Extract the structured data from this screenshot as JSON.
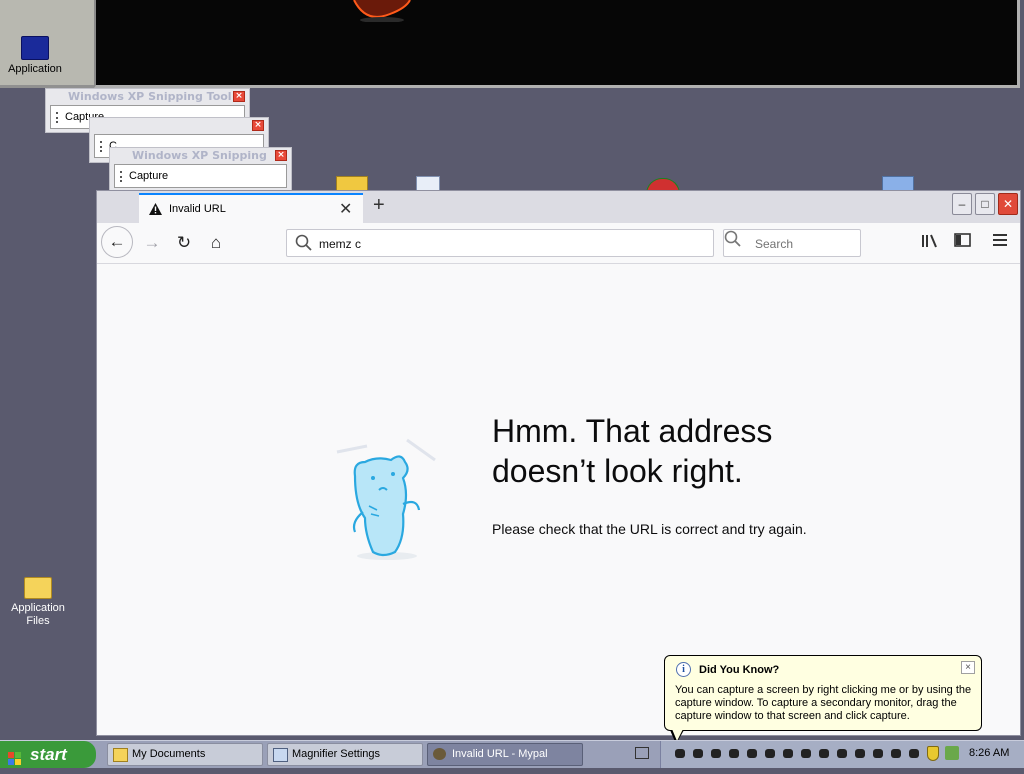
{
  "desktop": {
    "top_icon_label": "Application Files",
    "bottom_icon_label": "Application Files"
  },
  "snipping_tool": {
    "title": "Windows XP Snipping Tool",
    "capture_label": "Capture",
    "close_glyph": "×",
    "partial_label": "C"
  },
  "browser": {
    "tab_title": "Invalid URL",
    "tab_close": "✕",
    "new_tab": "+",
    "window_buttons": {
      "minimize": "–",
      "maximize": "□",
      "close": "✕"
    },
    "nav": {
      "back": "←",
      "forward": "→",
      "reload": "↻",
      "home": "⌂"
    },
    "url_value": "memz c",
    "search_placeholder": "Search",
    "toolbar_icons": [
      "library-icon",
      "sidebar-icon",
      "menu-icon"
    ],
    "error": {
      "title": "Hmm. That address doesn’t look right.",
      "description": "Please check that the URL is correct and try again."
    }
  },
  "balloon": {
    "title": "Did You Know?",
    "text": "You can capture a screen by right clicking me or by using the capture window. To capture a secondary monitor, drag the capture window to that screen and click capture.",
    "info_glyph": "i",
    "close_glyph": "×"
  },
  "taskbar": {
    "start_label": "start",
    "tasks": [
      {
        "label": "My Documents",
        "icon": "folder-icon"
      },
      {
        "label": "Magnifier Settings",
        "icon": "magnifier-icon"
      },
      {
        "label": "Invalid URL - Mypal",
        "icon": "mypal-icon",
        "active": true
      }
    ],
    "clock": "8:26 AM"
  },
  "colors": {
    "desktop": "#5a5a6e",
    "accent": "#0a84ff",
    "start_green": "#3a9a3a",
    "balloon_bg": "#ffffe1"
  }
}
